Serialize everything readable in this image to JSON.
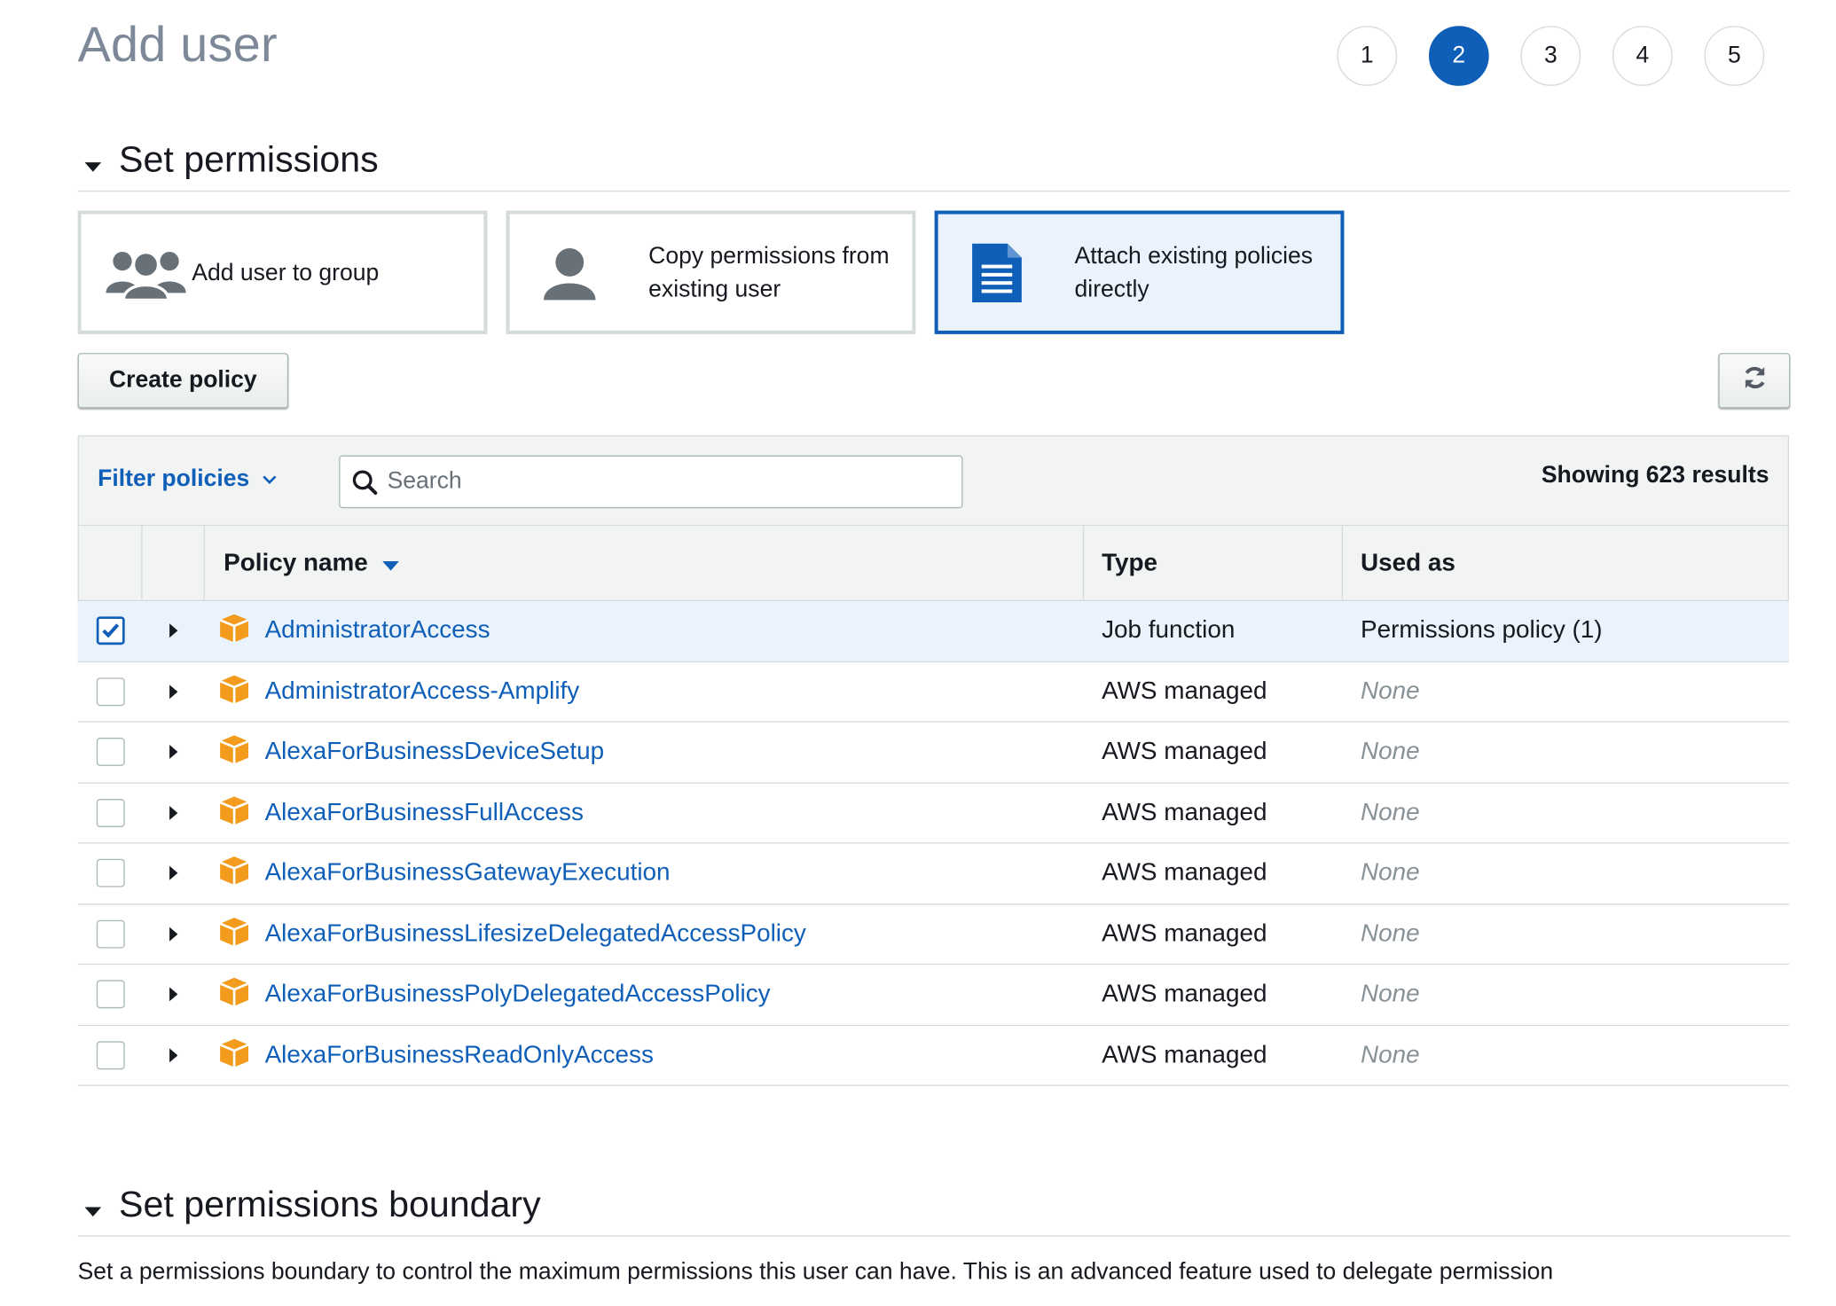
{
  "page": {
    "title": "Add user"
  },
  "wizard": {
    "steps": [
      "1",
      "2",
      "3",
      "4",
      "5"
    ],
    "active_step": "2"
  },
  "set_permissions": {
    "heading": "Set permissions",
    "options": [
      {
        "label": "Add user to group",
        "icon": "group-icon",
        "selected": false
      },
      {
        "label": "Copy permissions from existing user",
        "icon": "user-icon",
        "selected": false
      },
      {
        "label": "Attach existing policies directly",
        "icon": "document-icon",
        "selected": true
      }
    ],
    "create_policy_label": "Create policy",
    "refresh_icon": "refresh-icon"
  },
  "policies_table": {
    "filter_label": "Filter policies",
    "search_placeholder": "Search",
    "results_text": "Showing 623 results",
    "columns": {
      "name": "Policy name",
      "type": "Type",
      "used_as": "Used as"
    },
    "rows": [
      {
        "name": "AdministratorAccess",
        "type": "Job function",
        "used_as": "Permissions policy (1)",
        "checked": true
      },
      {
        "name": "AdministratorAccess-Amplify",
        "type": "AWS managed",
        "used_as": "None",
        "checked": false
      },
      {
        "name": "AlexaForBusinessDeviceSetup",
        "type": "AWS managed",
        "used_as": "None",
        "checked": false
      },
      {
        "name": "AlexaForBusinessFullAccess",
        "type": "AWS managed",
        "used_as": "None",
        "checked": false
      },
      {
        "name": "AlexaForBusinessGatewayExecution",
        "type": "AWS managed",
        "used_as": "None",
        "checked": false
      },
      {
        "name": "AlexaForBusinessLifesizeDelegatedAccessPolicy",
        "type": "AWS managed",
        "used_as": "None",
        "checked": false
      },
      {
        "name": "AlexaForBusinessPolyDelegatedAccessPolicy",
        "type": "AWS managed",
        "used_as": "None",
        "checked": false
      },
      {
        "name": "AlexaForBusinessReadOnlyAccess",
        "type": "AWS managed",
        "used_as": "None",
        "checked": false
      }
    ]
  },
  "permissions_boundary": {
    "heading": "Set permissions boundary",
    "description": "Set a permissions boundary to control the maximum permissions this user can have. This is an advanced feature used to delegate permission"
  },
  "colors": {
    "accent": "#0f5fb9",
    "package_icon": "#f29b1d",
    "selected_bg": "#eaf3fc",
    "border": "#d5dbdb"
  }
}
